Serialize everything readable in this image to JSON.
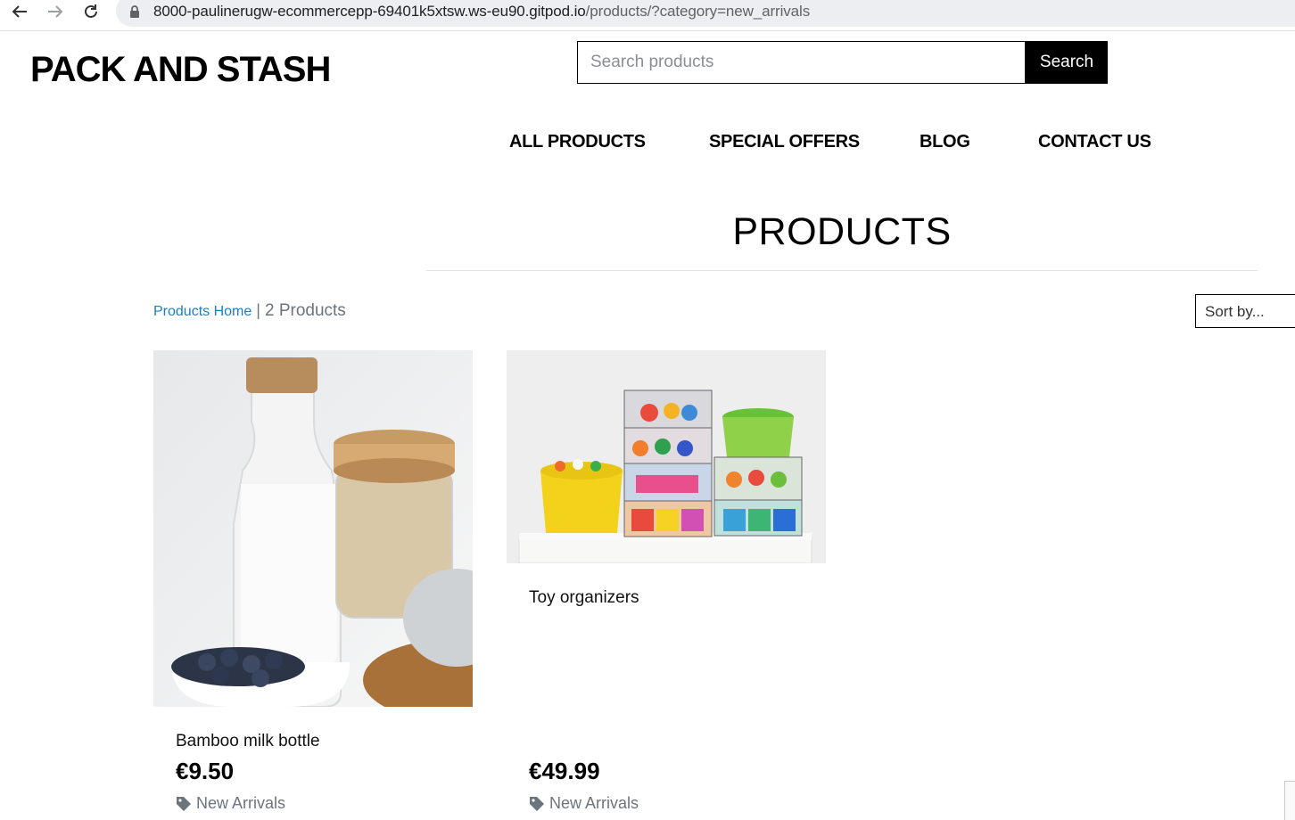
{
  "browser": {
    "url_host": "8000-paulinerugw-ecommercepp-69401k5xtsw.ws-eu90.gitpod.io",
    "url_path": "/products/?category=new_arrivals"
  },
  "header": {
    "logo": "PACK AND STASH",
    "search_placeholder": "Search products",
    "search_button": "Search"
  },
  "nav": {
    "all_products": "ALL PRODUCTS",
    "special_offers": "SPECIAL OFFERS",
    "blog": "BLOG",
    "contact_us": "CONTACT US"
  },
  "main": {
    "title": "PRODUCTS",
    "breadcrumb_link": "Products Home",
    "breadcrumb_sep": "|",
    "product_count": "2 Products",
    "sort_label": "Sort by..."
  },
  "products": [
    {
      "name": "Bamboo milk bottle",
      "price": "€9.50",
      "category": "New Arrivals"
    },
    {
      "name": "Toy organizers",
      "price": "€49.99",
      "category": "New Arrivals"
    }
  ],
  "icons": {
    "back": "arrow-left-icon",
    "forward": "arrow-right-icon",
    "reload": "reload-icon",
    "lock": "lock-icon",
    "tag": "tag-icon"
  },
  "colors": {
    "link": "#1a7fc1",
    "muted": "#6c757d",
    "button": "#000000"
  }
}
